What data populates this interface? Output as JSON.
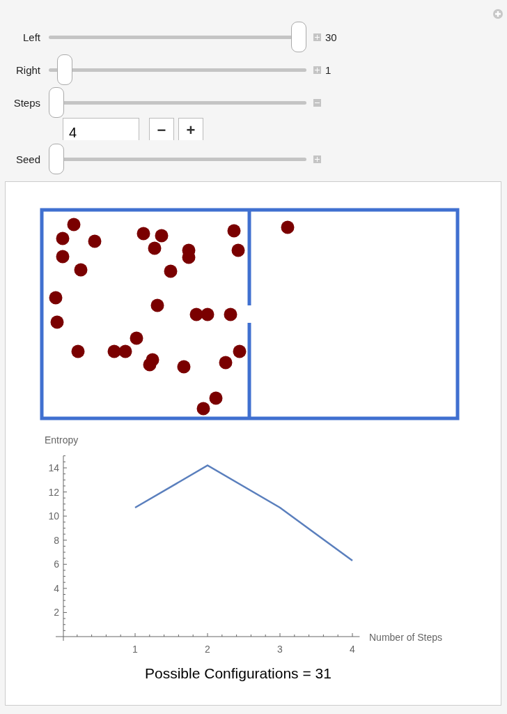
{
  "sliders": [
    {
      "label": "Left",
      "level": 1,
      "expanded": false,
      "value": "30"
    },
    {
      "label": "Right",
      "level": 0.035,
      "expanded": false,
      "value": "1"
    },
    {
      "label": "Steps",
      "level": 0,
      "expanded": true,
      "input": "4",
      "buttons": [
        "−",
        "+"
      ]
    },
    {
      "label": "Seed",
      "level": 0,
      "expanded": false
    }
  ],
  "output": {
    "chart_data": {
      "type": "line",
      "xlabel": "Number of Steps",
      "ylabel": "Entropy",
      "x": [
        1,
        2,
        3,
        4
      ],
      "series": [
        {
          "color": "#5a7fbd",
          "values": [
            10.7,
            14.2,
            10.7,
            6.3
          ]
        }
      ],
      "xlim": [
        0,
        4.1
      ],
      "ylim": [
        0,
        15
      ],
      "xticks": [
        1,
        2,
        3,
        4
      ],
      "yticks": [
        2,
        4,
        6,
        8,
        10,
        12,
        14
      ]
    },
    "caption": "Possible Configurations = 31"
  }
}
